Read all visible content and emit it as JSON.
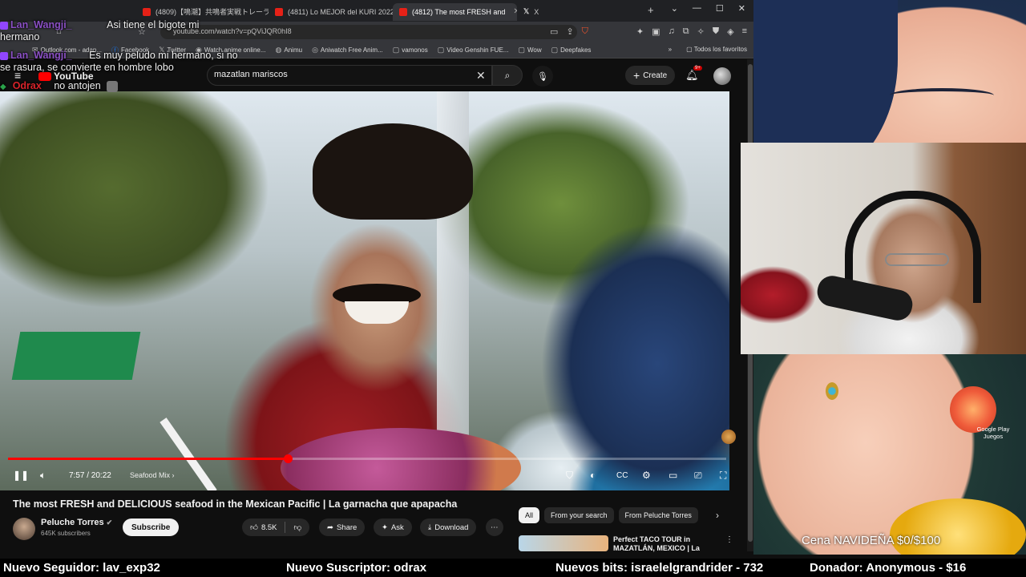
{
  "browser": {
    "tabs": [
      {
        "label": "(4809)【鳴潮】共鳴者実戦トレーラー"
      },
      {
        "label": "(4811) Lo MEJOR del KURI 2022 - Y"
      },
      {
        "label": "(4812) The most FRESH and"
      },
      {
        "label": "X"
      }
    ],
    "url": "youtube.com/watch?v=pQViJQR0hI8",
    "bookmarks": [
      {
        "label": "Outlook.com - adan..."
      },
      {
        "label": "Facebook"
      },
      {
        "label": "Twitter"
      },
      {
        "label": "Watch anime online..."
      },
      {
        "label": "Animu"
      },
      {
        "label": "Aniwatch Free Anim..."
      },
      {
        "label": "vamonos"
      },
      {
        "label": "Video Genshin FUE..."
      },
      {
        "label": "Wow"
      },
      {
        "label": "Deepfakes"
      }
    ],
    "bookmarks_all": "Todos los favoritos"
  },
  "youtube": {
    "logo_text": "YouTube",
    "search_value": "mazatlan mariscos",
    "create_label": "Create",
    "notif_count": "9+",
    "player": {
      "time": "7:57 / 20:22",
      "chapter": "Seafood Mix",
      "progress_fraction": 0.39
    },
    "video_title": "The most FRESH and DELICIOUS seafood in the Mexican Pacific | La garnacha que apapacha",
    "channel": {
      "name": "Peluche Torres",
      "subs": "645K subscribers",
      "subscribe_label": "Subscribe"
    },
    "actions": {
      "likes": "8.5K",
      "share": "Share",
      "ask": "Ask",
      "download": "Download"
    },
    "chips": [
      {
        "label": "All"
      },
      {
        "label": "From your search"
      },
      {
        "label": "From Peluche Torres"
      }
    ],
    "recommended": {
      "title": "Perfect TACO TOUR in MAZATLÁN, MEXICO | La"
    }
  },
  "chat": [
    {
      "user": "Lan_Wangji_",
      "text": "Asi tiene el bigote mi hermano"
    },
    {
      "user": "Lan_Wangji_",
      "text": "Es muy peludo mi hermano, si no se rasura, se convierte en hombre lobo"
    },
    {
      "user": "Odrax",
      "text": "no antojen"
    }
  ],
  "stream": {
    "gplay": "Google Play Juegos",
    "donation_goal": "Cena NAVIDEÑA $0/$100",
    "ticker": [
      {
        "text": "Nuevo Seguidor: lav_exp32"
      },
      {
        "text": "Nuevo Suscriptor: odrax"
      },
      {
        "text": "Nuevos bits: israelelgrandrider - 732"
      },
      {
        "text": "Donador: Anonymous - $16"
      }
    ]
  },
  "colors": {
    "accent": "#ff0000",
    "chat_user": "#8a4fc4",
    "chat_user_alt": "#d8232a"
  }
}
